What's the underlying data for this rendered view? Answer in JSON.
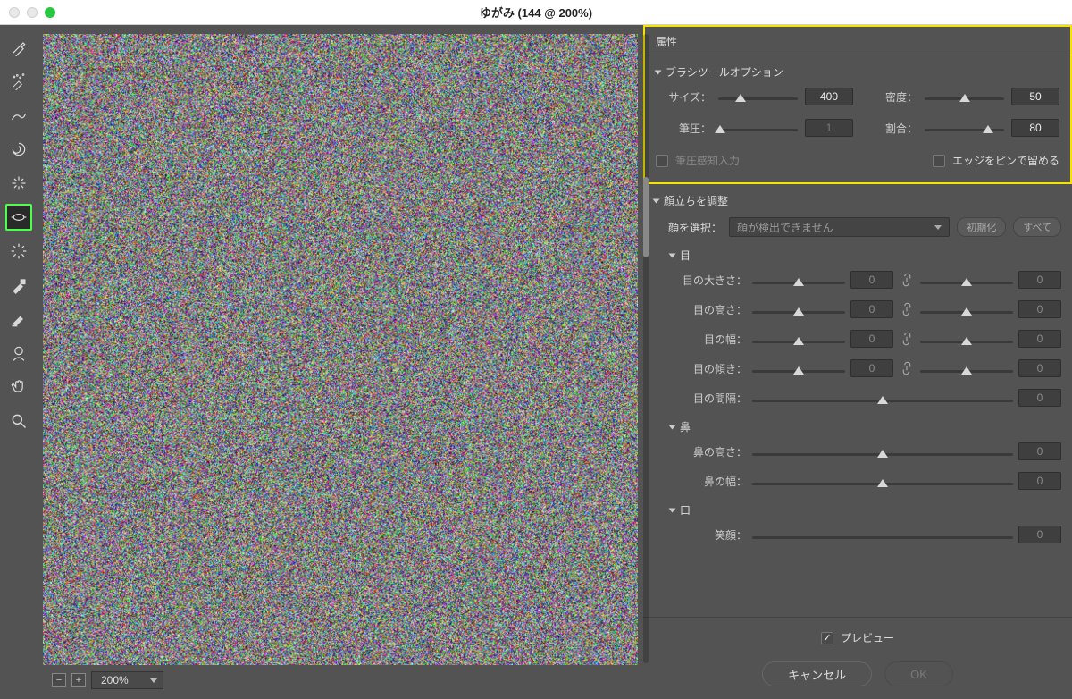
{
  "title": "ゆがみ (144 @ 200%)",
  "zoom": "200%",
  "panel_title": "属性",
  "brush": {
    "header": "ブラシツールオプション",
    "size_label": "サイズ：",
    "size_value": "400",
    "density_label": "密度：",
    "density_value": "50",
    "pressure_label": "筆圧：",
    "pressure_value": "1",
    "rate_label": "割合：",
    "rate_value": "80",
    "stylus_label": "筆圧感知入力",
    "pin_label": "エッジをピンで留める"
  },
  "face": {
    "header": "顔立ちを調整",
    "select_label": "顔を選択：",
    "select_value": "顔が検出できません",
    "reset_btn": "初期化",
    "all_btn": "すべて",
    "eyes": {
      "header": "目",
      "size": "目の大きさ：",
      "height": "目の高さ：",
      "width": "目の幅：",
      "tilt": "目の傾き：",
      "distance": "目の間隔：",
      "v": "0"
    },
    "nose": {
      "header": "鼻",
      "height": "鼻の高さ：",
      "width": "鼻の幅：",
      "v": "0"
    },
    "mouth": {
      "header": "口",
      "smile": "笑顔：",
      "v": "0"
    }
  },
  "preview_label": "プレビュー",
  "cancel_label": "キャンセル",
  "ok_label": "OK"
}
